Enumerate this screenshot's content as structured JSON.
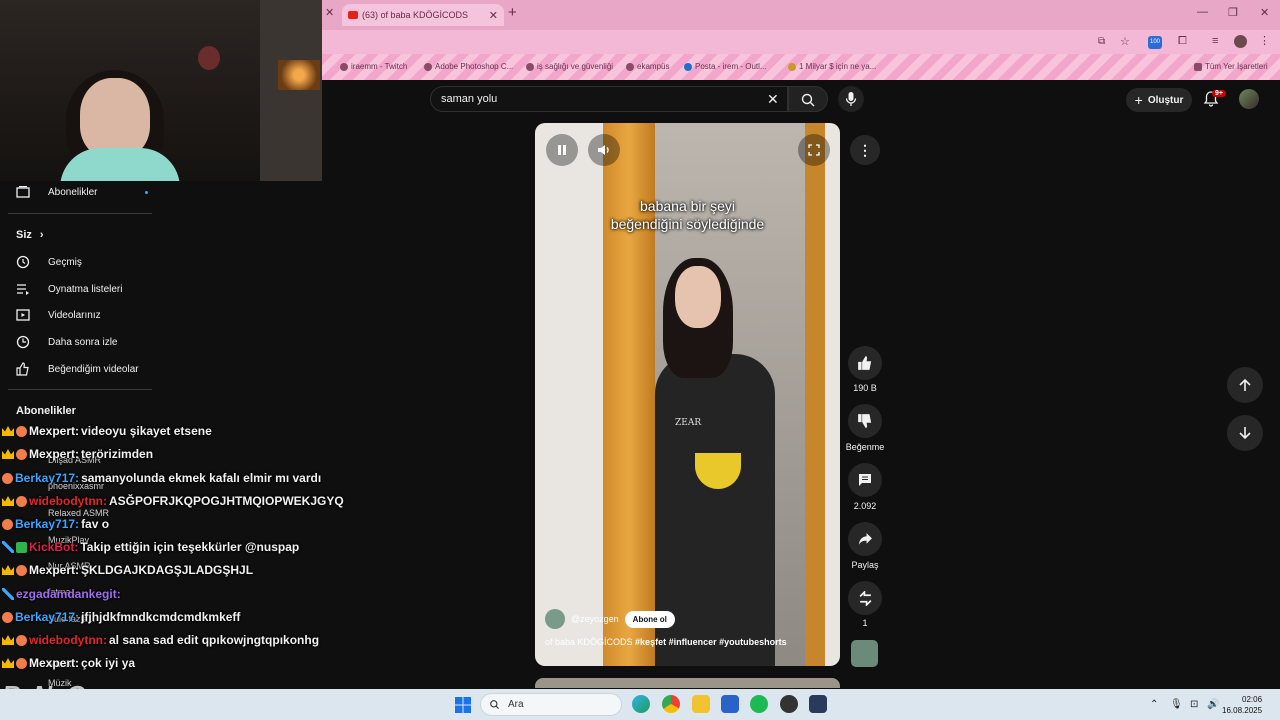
{
  "browser": {
    "tab_title": "(63) of baba KDÖGİCODS",
    "bookmarks": [
      "iraemm - Twitch",
      "Adobe Photoshop C...",
      "iş sağlığı ve güvenliği",
      "ekampüs",
      "Posta - irem - Outl...",
      "1 Milyar $ için ne ya..."
    ],
    "bookmarks_all": "Tüm Yer İşaretleri",
    "ext_badge": "100"
  },
  "sidebar": {
    "top_item": "Abonelikler",
    "you_header": "Siz",
    "you_chevron": "›",
    "you_items": [
      "Geçmiş",
      "Oynatma listeleri",
      "Videolarınız",
      "Daha sonra izle",
      "Beğendiğim videolar"
    ],
    "subs_header": "Abonelikler",
    "subs_items": [
      "Dilşad ASMR",
      "phoenixxasmr",
      "Relaxed ASMR",
      "MuzikPlay",
      "Nur ASMR",
      "fatma ...",
      "Şule fazla...",
      "Müzik",
      "Müzik"
    ]
  },
  "chat": [
    {
      "user": "Mexpert:",
      "msg": "videoyu şikayet etsene",
      "color": "#f5f5f5"
    },
    {
      "user": "Mexpert:",
      "msg": "terörizimden",
      "color": "#f5f5f5"
    },
    {
      "user": "Berkay717:",
      "msg": "samanyolunda ekmek kafalı elmir mı vardı",
      "color": "#3ea6ff"
    },
    {
      "user": "widebodytnn:",
      "msg": "ASĞPOFRJKQPOGJHTMQIOPWEKJGYQ",
      "color": "#e02828"
    },
    {
      "user": "Berkay717:",
      "msg": "fav o",
      "color": "#3ea6ff"
    },
    {
      "user": "KickBot:",
      "msg": "Takip ettiğin için teşekkürler @nuspap",
      "color": "#e0204a"
    },
    {
      "user": "Mexpert:",
      "msg": "ŞKLDGAJKDAGŞJLADGŞHJL",
      "color": "#f5f5f5"
    },
    {
      "user": "ezgadamdankegit:",
      "msg": "",
      "color": "#a06cf0"
    },
    {
      "user": "Berkay717:",
      "msg": "jfjhjdkfmndkcmdcmdkmkeff",
      "color": "#3ea6ff"
    },
    {
      "user": "widebodytnn:",
      "msg": "al sana sad edit qpıkowjngtqpıkonhg",
      "color": "#e02828"
    },
    {
      "user": "Mexpert:",
      "msg": "çok iyi ya",
      "color": "#f5f5f5"
    }
  ],
  "watermark": "ByNoGame",
  "header": {
    "search_value": "saman yolu",
    "create_label": "Oluştur",
    "notif_count": "9+"
  },
  "video": {
    "caption_line1": "babana bir şeyi",
    "caption_line2": "beğendiğini söylediğinde",
    "shirt_text": "ZEAR",
    "channel": "@zeyozgen",
    "subscribe": "Abone ol",
    "title_plain": "of baba KDÖGİCODS ",
    "title_tags": "#keşfet #influencer #youtubeshorts"
  },
  "actions": {
    "likes": "190 B",
    "dislike": "Beğenme",
    "comments": "2.092",
    "share": "Paylaş",
    "remix": "1"
  },
  "taskbar": {
    "search": "Ara",
    "time": "02:06",
    "date": "16.08.2025"
  },
  "colors": {
    "accent": "#3ea6ff",
    "yt_bg": "#0f0f0f",
    "browser_pink": "#f2a6cb",
    "notif_red": "#cc0000"
  }
}
